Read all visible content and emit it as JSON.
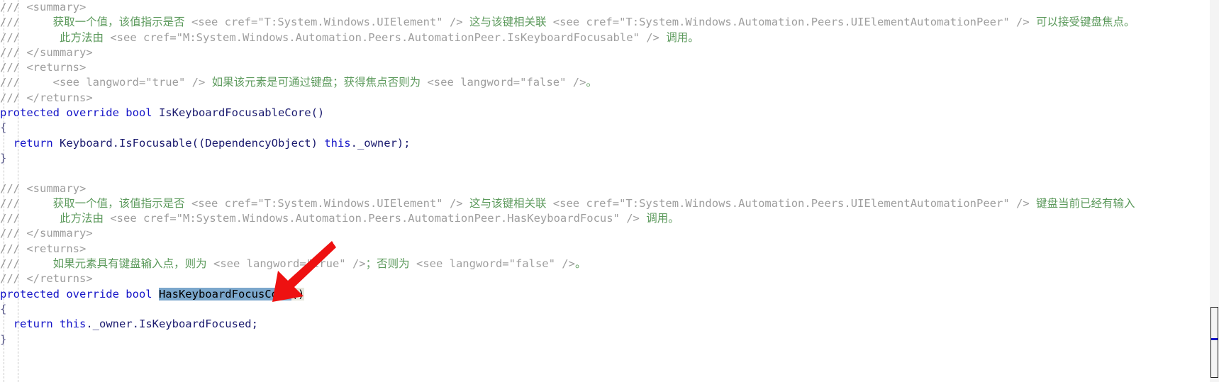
{
  "editor": {
    "language": "csharp",
    "accent_selection_color": "#7ba7cc",
    "reference_highlight_color": "#e6e6dc",
    "comment_color": "#9a9a9a",
    "doc_text_color": "#5c9a5c",
    "keyword_color": "#1414c8",
    "identifier_color": "#1a1a6e",
    "annotation_arrow_color": "#ee1111"
  },
  "lines": [
    {
      "id": "line-1",
      "kind": "doc",
      "tokens": [
        {
          "t": "comment",
          "v": "/// "
        },
        {
          "t": "doctag",
          "v": "<summary>"
        }
      ]
    },
    {
      "id": "line-2",
      "kind": "doc",
      "tokens": [
        {
          "t": "comment",
          "v": "///     "
        },
        {
          "t": "doctext",
          "v": "获取一个值，该值指示是否 "
        },
        {
          "t": "doctag",
          "v": "<see cref=\"T:System.Windows.UIElement\" />"
        },
        {
          "t": "doctext",
          "v": " 这与该键相关联 "
        },
        {
          "t": "doctag",
          "v": "<see cref=\"T:System.Windows.Automation.Peers.UIElementAutomationPeer\" />"
        },
        {
          "t": "doctext",
          "v": " 可以接受键盘焦点。"
        }
      ]
    },
    {
      "id": "line-3",
      "kind": "doc",
      "tokens": [
        {
          "t": "comment",
          "v": "///      "
        },
        {
          "t": "doctext",
          "v": "此方法由 "
        },
        {
          "t": "doctag",
          "v": "<see cref=\"M:System.Windows.Automation.Peers.AutomationPeer.IsKeyboardFocusable\" />"
        },
        {
          "t": "doctext",
          "v": " 调用。"
        }
      ]
    },
    {
      "id": "line-4",
      "kind": "doc",
      "tokens": [
        {
          "t": "comment",
          "v": "/// "
        },
        {
          "t": "doctag",
          "v": "</summary>"
        }
      ]
    },
    {
      "id": "line-5",
      "kind": "doc",
      "tokens": [
        {
          "t": "comment",
          "v": "/// "
        },
        {
          "t": "doctag",
          "v": "<returns>"
        }
      ]
    },
    {
      "id": "line-6",
      "kind": "doc",
      "tokens": [
        {
          "t": "comment",
          "v": "///     "
        },
        {
          "t": "doctag",
          "v": "<see langword=\"true\" />"
        },
        {
          "t": "doctext",
          "v": " 如果该元素是可通过键盘；获得焦点否则为 "
        },
        {
          "t": "doctag",
          "v": "<see langword=\"false\" />"
        },
        {
          "t": "doctext",
          "v": "。"
        }
      ]
    },
    {
      "id": "line-7",
      "kind": "doc",
      "tokens": [
        {
          "t": "comment",
          "v": "/// "
        },
        {
          "t": "doctag",
          "v": "</returns>"
        }
      ]
    },
    {
      "id": "line-8",
      "kind": "code",
      "tokens": [
        {
          "t": "kw",
          "v": "protected override bool "
        },
        {
          "t": "plain",
          "v": "IsKeyboardFocusableCore()"
        }
      ]
    },
    {
      "id": "line-9",
      "kind": "code",
      "tokens": [
        {
          "t": "brace",
          "v": "{"
        }
      ]
    },
    {
      "id": "line-10",
      "kind": "code",
      "tokens": [
        {
          "t": "plain",
          "v": "  "
        },
        {
          "t": "kw",
          "v": "return "
        },
        {
          "t": "plain",
          "v": "Keyboard.IsFocusable((DependencyObject) "
        },
        {
          "t": "kw",
          "v": "this"
        },
        {
          "t": "plain",
          "v": "._owner);"
        }
      ]
    },
    {
      "id": "line-11",
      "kind": "code",
      "tokens": [
        {
          "t": "brace",
          "v": "}"
        }
      ]
    },
    {
      "id": "line-12",
      "kind": "blank",
      "tokens": []
    },
    {
      "id": "line-13",
      "kind": "doc",
      "tokens": [
        {
          "t": "comment",
          "v": "/// "
        },
        {
          "t": "doctag",
          "v": "<summary>"
        }
      ]
    },
    {
      "id": "line-14",
      "kind": "doc",
      "tokens": [
        {
          "t": "comment",
          "v": "///     "
        },
        {
          "t": "doctext",
          "v": "获取一个值，该值指示是否 "
        },
        {
          "t": "doctag",
          "v": "<see cref=\"T:System.Windows.UIElement\" />"
        },
        {
          "t": "doctext",
          "v": " 这与该键相关联 "
        },
        {
          "t": "doctag",
          "v": "<see cref=\"T:System.Windows.Automation.Peers.UIElementAutomationPeer\" />"
        },
        {
          "t": "doctext",
          "v": " 键盘当前已经有输入"
        }
      ]
    },
    {
      "id": "line-15",
      "kind": "doc",
      "tokens": [
        {
          "t": "comment",
          "v": "///      "
        },
        {
          "t": "doctext",
          "v": "此方法由 "
        },
        {
          "t": "doctag",
          "v": "<see cref=\"M:System.Windows.Automation.Peers.AutomationPeer.HasKeyboardFocus\" />"
        },
        {
          "t": "doctext",
          "v": " 调用。"
        }
      ]
    },
    {
      "id": "line-16",
      "kind": "doc",
      "tokens": [
        {
          "t": "comment",
          "v": "/// "
        },
        {
          "t": "doctag",
          "v": "</summary>"
        }
      ]
    },
    {
      "id": "line-17",
      "kind": "doc",
      "tokens": [
        {
          "t": "comment",
          "v": "/// "
        },
        {
          "t": "doctag",
          "v": "<returns>"
        }
      ]
    },
    {
      "id": "line-18",
      "kind": "doc",
      "tokens": [
        {
          "t": "comment",
          "v": "///     "
        },
        {
          "t": "doctext",
          "v": "如果元素具有键盘输入点，则为 "
        },
        {
          "t": "doctag",
          "v": "<see langword=\"true\" />"
        },
        {
          "t": "doctext",
          "v": "；否则为 "
        },
        {
          "t": "doctag",
          "v": "<see langword=\"false\" />"
        },
        {
          "t": "doctext",
          "v": "。"
        }
      ]
    },
    {
      "id": "line-19",
      "kind": "doc",
      "tokens": [
        {
          "t": "comment",
          "v": "/// "
        },
        {
          "t": "doctag",
          "v": "</returns>"
        }
      ]
    },
    {
      "id": "line-20",
      "kind": "code",
      "tokens": [
        {
          "t": "kw",
          "v": "protected override bool "
        },
        {
          "t": "sel",
          "v": "HasKeyboardFocusCore"
        },
        {
          "t": "caret",
          "v": ""
        },
        {
          "t": "refhl",
          "v": "()"
        }
      ]
    },
    {
      "id": "line-21",
      "kind": "code",
      "tokens": [
        {
          "t": "brace",
          "v": "{"
        }
      ]
    },
    {
      "id": "line-22",
      "kind": "code",
      "tokens": [
        {
          "t": "plain",
          "v": "  "
        },
        {
          "t": "kw",
          "v": "return "
        },
        {
          "t": "kw",
          "v": "this"
        },
        {
          "t": "plain",
          "v": "._owner.IsKeyboardFocused;"
        }
      ]
    },
    {
      "id": "line-23",
      "kind": "code",
      "tokens": [
        {
          "t": "brace",
          "v": "}"
        }
      ]
    }
  ],
  "scrollbar": {
    "thumb_present": true,
    "marker_color": "#1414c8"
  },
  "annotation": {
    "type": "red-arrow",
    "points_to": "HasKeyboardFocusCore",
    "color": "#ee1111"
  }
}
